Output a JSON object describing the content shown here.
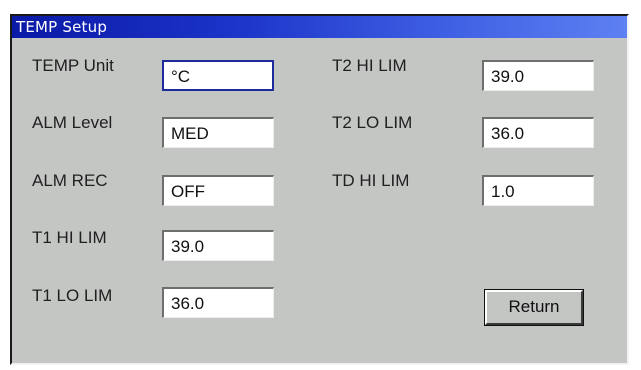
{
  "window": {
    "title": "TEMP Setup"
  },
  "left_column": [
    {
      "label": "TEMP Unit",
      "value": "°C"
    },
    {
      "label": "ALM Level",
      "value": "MED"
    },
    {
      "label": "ALM REC",
      "value": "OFF"
    },
    {
      "label": "T1 HI LIM",
      "value": "39.0"
    },
    {
      "label": "T1 LO LIM",
      "value": "36.0"
    }
  ],
  "right_column": [
    {
      "label": "T2 HI LIM",
      "value": "39.0"
    },
    {
      "label": "T2 LO LIM",
      "value": "36.0"
    },
    {
      "label": "TD HI LIM",
      "value": "1.0"
    }
  ],
  "buttons": {
    "return_label": "Return"
  },
  "colors": {
    "titlebar_start": "#0b1aa6",
    "titlebar_end": "#5d80f2",
    "panel_background": "#c4c6c4",
    "focus_border": "#1c2a9c"
  }
}
